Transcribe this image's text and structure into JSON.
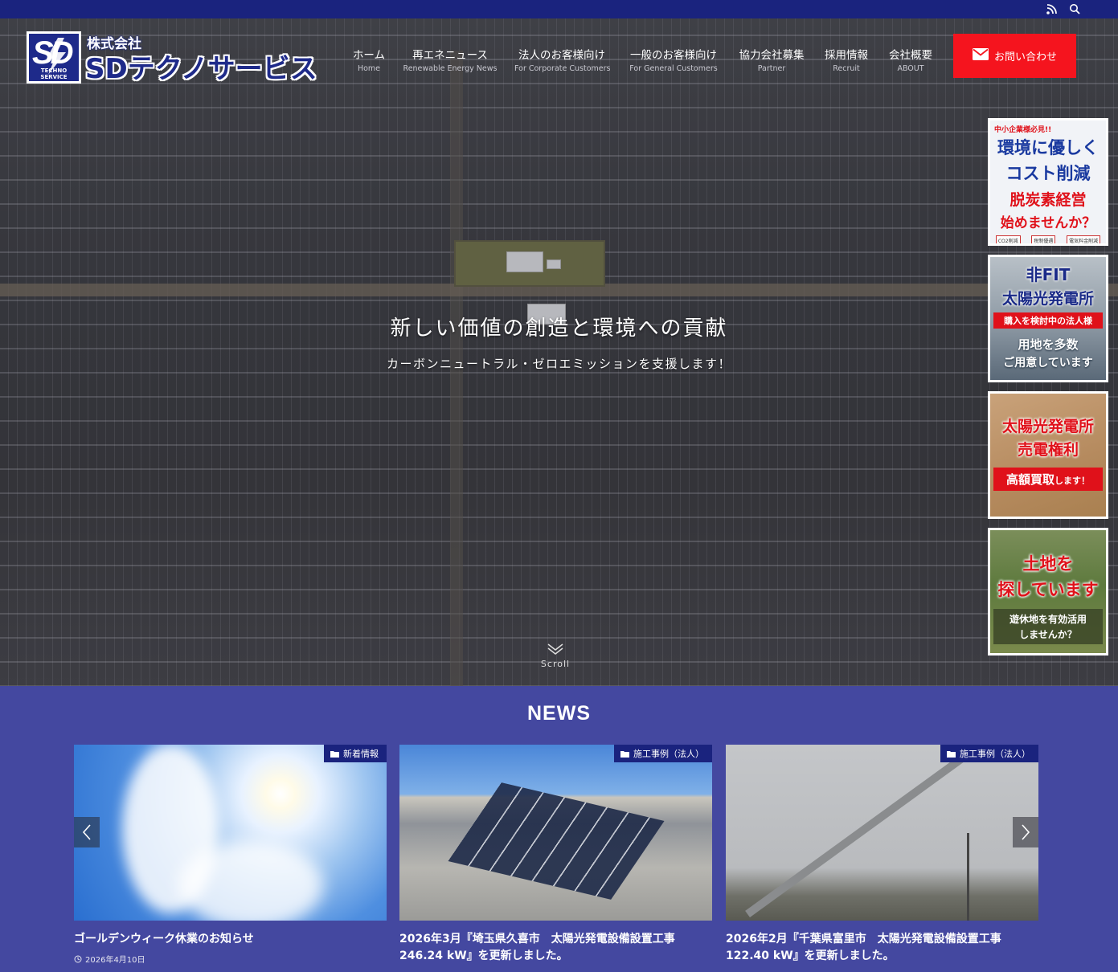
{
  "header": {
    "logo_sub": "株式会社",
    "logo_main": "SDテクノサービス",
    "logo_mark": "SD",
    "logo_mark_text": "TECHNO SERVICE"
  },
  "topbar": {
    "icons": [
      "rss-icon",
      "search-icon"
    ]
  },
  "nav": [
    {
      "ja": "ホーム",
      "en": "Home"
    },
    {
      "ja": "再エネニュース",
      "en": "Renewable Energy News"
    },
    {
      "ja": "法人のお客様向け",
      "en": "For Corporate Customers"
    },
    {
      "ja": "一般のお客様向け",
      "en": "For General Customers"
    },
    {
      "ja": "協力会社募集",
      "en": "Partner"
    },
    {
      "ja": "採用情報",
      "en": "Recruit"
    },
    {
      "ja": "会社概要",
      "en": "ABOUT"
    }
  ],
  "contact": {
    "label": "お問い合わせ",
    "icon": "mail-icon"
  },
  "hero": {
    "title": "新しい価値の創造と環境への貢献",
    "subtitle": "カーボンニュートラル・ゼロエミッションを支援します！",
    "scroll": "Scroll"
  },
  "banners": [
    {
      "lines": [
        "中小企業様必見!!",
        "環境に優しく",
        "コスト削減",
        "脱炭素経営",
        "始めませんか？"
      ],
      "tags": [
        "CO2削減",
        "税制優遇",
        "電気料金削減"
      ]
    },
    {
      "lines": [
        "非FIT",
        "太陽光発電所",
        "購入を検討中の法人様",
        "用地を多数",
        "ご用意しています"
      ]
    },
    {
      "lines": [
        "太陽光発電所",
        "売電権利",
        "高額買取",
        "します！"
      ]
    },
    {
      "lines": [
        "土地を",
        "探しています",
        "遊休地を有効活用",
        "しませんか？"
      ]
    }
  ],
  "news": {
    "heading": "NEWS",
    "items": [
      {
        "category": "新着情報",
        "title": "ゴールデンウィーク休業のお知らせ",
        "date": "2026年4月10日"
      },
      {
        "category": "施工事例（法人）",
        "title": "2026年3月『埼玉県久喜市　太陽光発電設備設置工事 246.24 kW』を更新しました。",
        "date": ""
      },
      {
        "category": "施工事例（法人）",
        "title": "2026年2月『千葉県富里市　太陽光発電設備設置工事 122.40 kW』を更新しました。",
        "date": ""
      }
    ]
  },
  "colors": {
    "topbar": "#1a237e",
    "accent": "#f5141e",
    "news_bg": "#4448a0",
    "brand": "#1e2a8a"
  }
}
